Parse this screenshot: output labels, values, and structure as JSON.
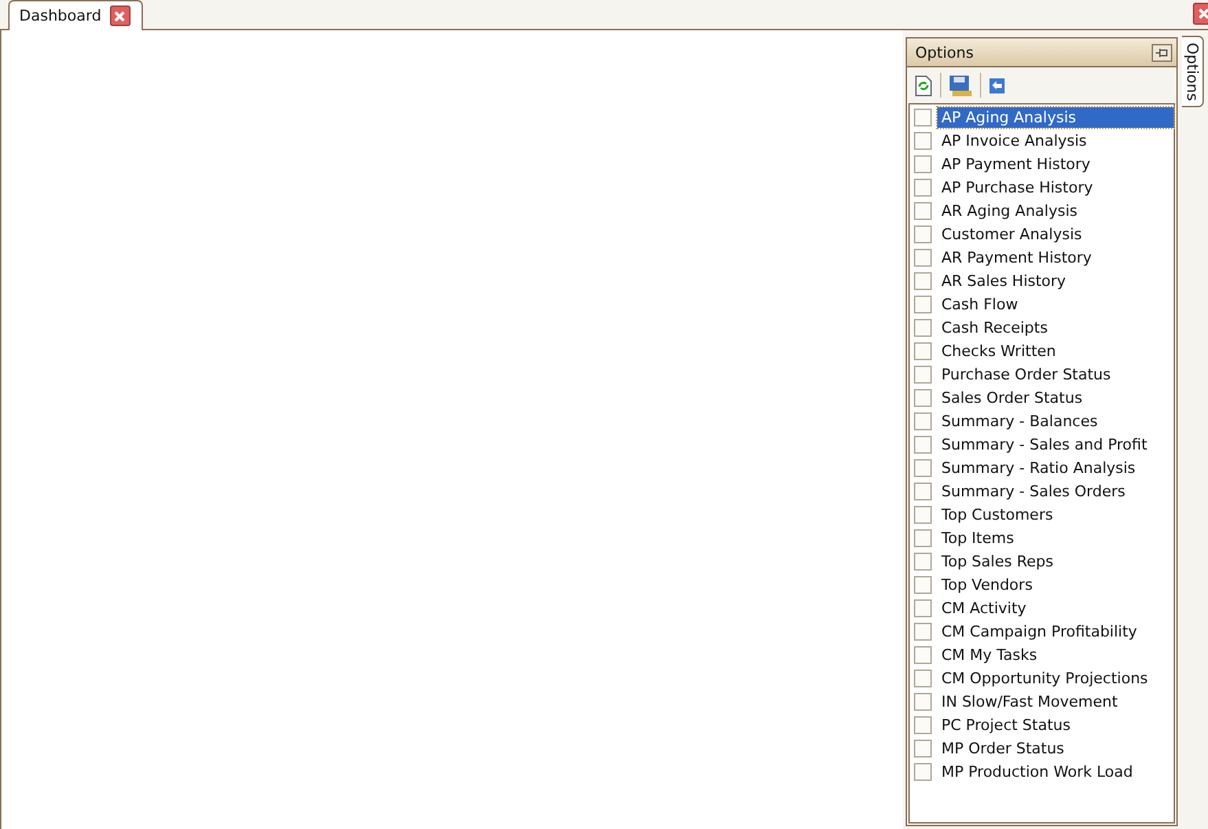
{
  "tabs": [
    {
      "label": "Dashboard",
      "selected": true
    }
  ],
  "options_panel": {
    "title": "Options",
    "side_tab": "Options",
    "items": [
      {
        "label": "AP Aging Analysis",
        "checked": false,
        "selected": true
      },
      {
        "label": "AP Invoice Analysis",
        "checked": false,
        "selected": false
      },
      {
        "label": "AP Payment History",
        "checked": false,
        "selected": false
      },
      {
        "label": "AP Purchase History",
        "checked": false,
        "selected": false
      },
      {
        "label": "AR Aging Analysis",
        "checked": false,
        "selected": false
      },
      {
        "label": "Customer Analysis",
        "checked": false,
        "selected": false
      },
      {
        "label": "AR Payment History",
        "checked": false,
        "selected": false
      },
      {
        "label": "AR Sales History",
        "checked": false,
        "selected": false
      },
      {
        "label": "Cash Flow",
        "checked": false,
        "selected": false
      },
      {
        "label": "Cash Receipts",
        "checked": false,
        "selected": false
      },
      {
        "label": "Checks Written",
        "checked": false,
        "selected": false
      },
      {
        "label": "Purchase Order Status",
        "checked": false,
        "selected": false
      },
      {
        "label": "Sales Order Status",
        "checked": false,
        "selected": false
      },
      {
        "label": "Summary - Balances",
        "checked": false,
        "selected": false
      },
      {
        "label": "Summary - Sales and Profit",
        "checked": false,
        "selected": false
      },
      {
        "label": "Summary - Ratio Analysis",
        "checked": false,
        "selected": false
      },
      {
        "label": "Summary - Sales Orders",
        "checked": false,
        "selected": false
      },
      {
        "label": "Top Customers",
        "checked": false,
        "selected": false
      },
      {
        "label": "Top Items",
        "checked": false,
        "selected": false
      },
      {
        "label": "Top Sales Reps",
        "checked": false,
        "selected": false
      },
      {
        "label": "Top Vendors",
        "checked": false,
        "selected": false
      },
      {
        "label": "CM Activity",
        "checked": false,
        "selected": false
      },
      {
        "label": "CM Campaign Profitability",
        "checked": false,
        "selected": false
      },
      {
        "label": "CM My Tasks",
        "checked": false,
        "selected": false
      },
      {
        "label": "CM Opportunity Projections",
        "checked": false,
        "selected": false
      },
      {
        "label": "IN Slow/Fast Movement",
        "checked": false,
        "selected": false
      },
      {
        "label": "PC Project Status",
        "checked": false,
        "selected": false
      },
      {
        "label": "MP Order Status",
        "checked": false,
        "selected": false
      },
      {
        "label": "MP Production Work Load",
        "checked": false,
        "selected": false
      }
    ]
  }
}
